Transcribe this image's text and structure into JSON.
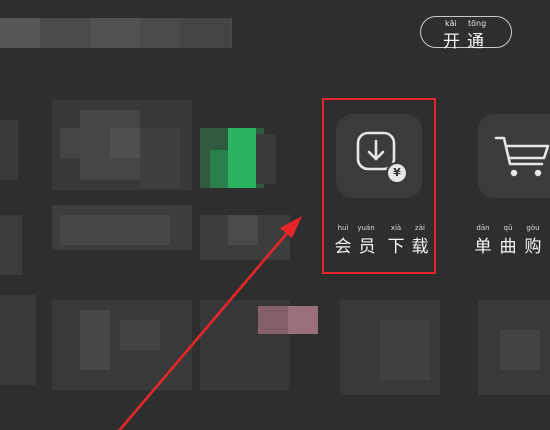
{
  "open_button": {
    "pinyin": [
      "kāi",
      "tōng"
    ],
    "chars": [
      "开",
      "通"
    ]
  },
  "member_download": {
    "pinyin": [
      "huì",
      "yuán",
      "xià",
      "zài"
    ],
    "chars": [
      "会",
      "员",
      "下",
      "载"
    ],
    "icon": "download-icon",
    "badge_icon": "yen-coin-icon",
    "badge_text": "¥"
  },
  "single_purchase": {
    "pinyin": [
      "dān",
      "qǔ",
      "gòu"
    ],
    "chars": [
      "单",
      "曲",
      "购"
    ],
    "icon": "shopping-cart-icon"
  },
  "colors": {
    "highlight": "#e8262a",
    "background": "#2e2e2e",
    "tile": "#3b3b3b"
  }
}
